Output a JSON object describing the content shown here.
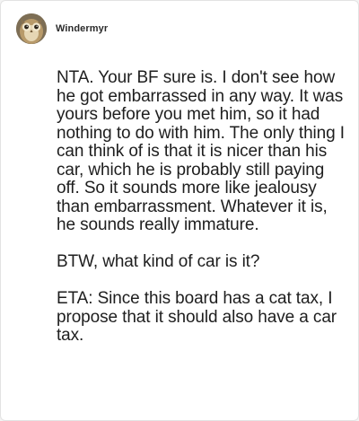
{
  "author": {
    "username": "Windermyr",
    "avatar_icon": "owl-avatar-icon"
  },
  "post": {
    "paragraphs": [
      "NTA. Your BF sure is. I don't see how he got embarrassed in any way. It was yours before you met him, so it had nothing to do with him. The only thing I can think of is that it is nicer than his car, which he is probably still paying off. So it sounds more like jealousy than embarrassment. Whatever it is, he sounds really immature.",
      "BTW, what kind of car is it?",
      "ETA: Since this board has a cat tax, I propose that it should also have a car tax."
    ]
  }
}
